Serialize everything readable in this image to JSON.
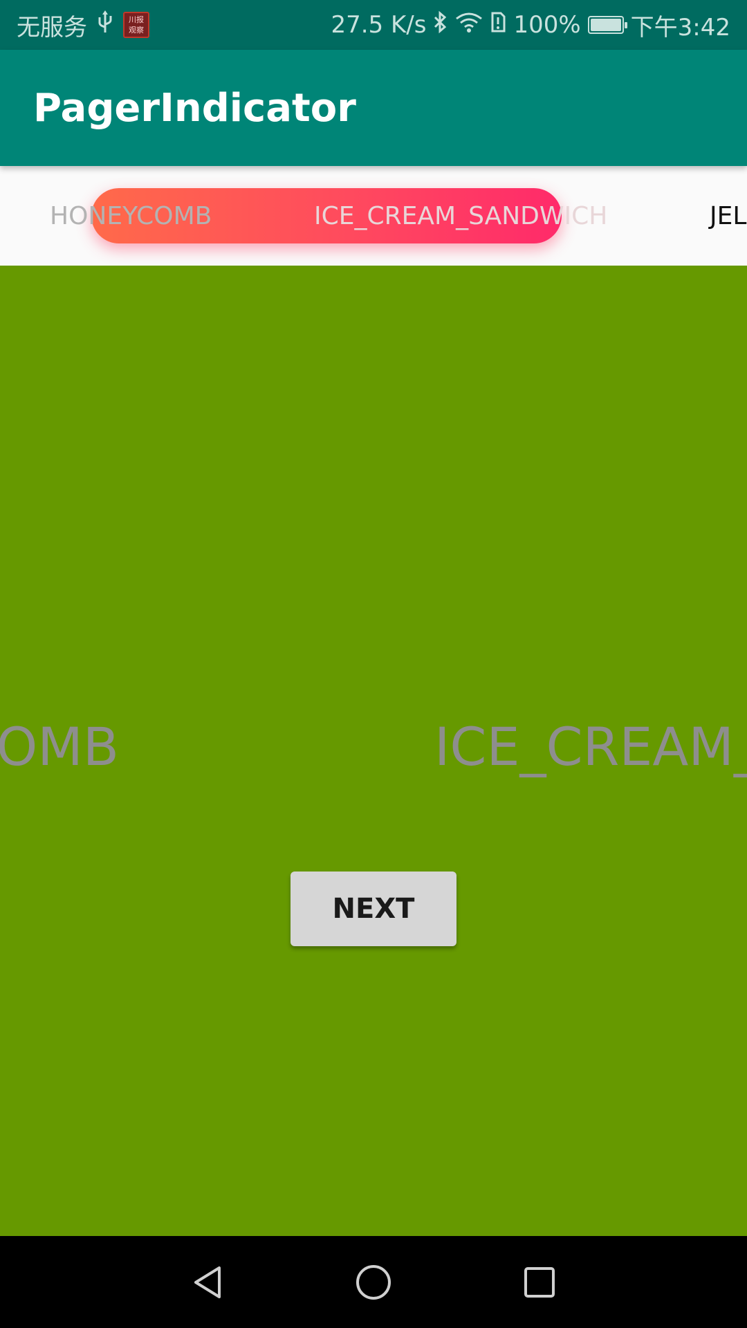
{
  "status_bar": {
    "carrier": "无服务",
    "usb_symbol": "ψ",
    "stamp_text": "川报观察",
    "net_speed": "27.5 K/s",
    "battery_percent": "100%",
    "battery_level": 1.0,
    "time": "下午3:42",
    "icons": [
      "usb-icon",
      "app-stamp-icon",
      "bluetooth-icon",
      "wifi-icon",
      "sim-alert-icon",
      "battery-charging-icon"
    ]
  },
  "app_bar": {
    "title": "PagerIndicator"
  },
  "indicator": {
    "tabs": [
      "HONEYCOMB",
      "ICE_CREAM_SANDWICH",
      "JELL"
    ],
    "selected_index": 1,
    "pill_gradient": [
      "#ff6a4a",
      "#ff2a6a"
    ]
  },
  "pager": {
    "left_page_label": "COMB",
    "right_page_label": "ICE_CREAM_S",
    "background_color": "#669900"
  },
  "next_button": {
    "label": "NEXT"
  },
  "nav_bar": {
    "icons": [
      "back-icon",
      "home-icon",
      "recent-apps-icon"
    ]
  },
  "colors": {
    "status_bar": "#006b60",
    "app_bar": "#008577",
    "accent": "#ff4a5e"
  }
}
